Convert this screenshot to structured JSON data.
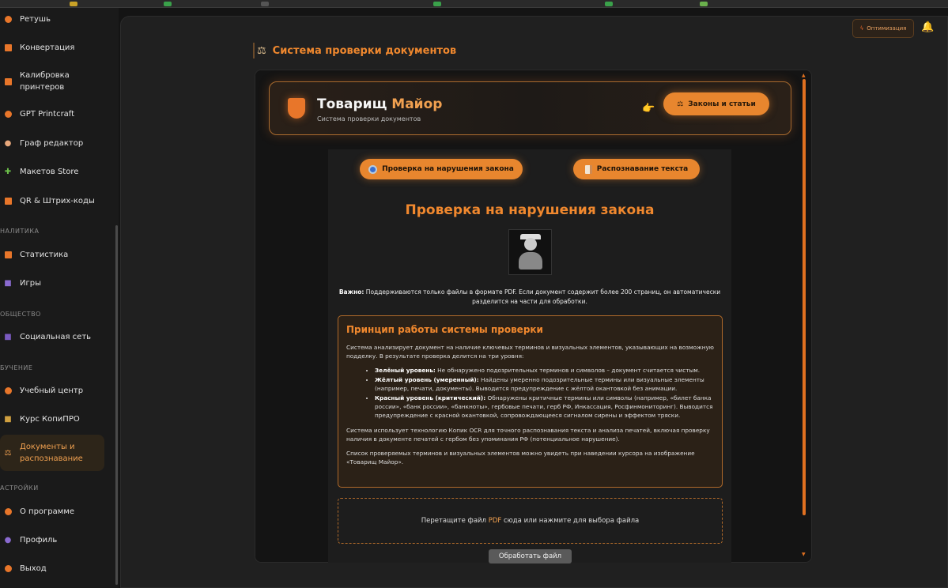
{
  "sidebar": {
    "items": [
      {
        "label": "Ретушь",
        "icon": "retouch-icon"
      },
      {
        "label": "Конвертация",
        "icon": "convert-icon"
      },
      {
        "label": "Калибровка принтеров",
        "icon": "calibration-icon"
      },
      {
        "label": "GPT Printcraft",
        "icon": "gpt-icon"
      },
      {
        "label": "Граф редактор",
        "icon": "palette-icon"
      },
      {
        "label": "Макетов Store",
        "icon": "puzzle-icon"
      },
      {
        "label": "QR & Штрих-коды",
        "icon": "qr-icon"
      },
      {
        "label": "Статистика",
        "icon": "stats-icon"
      },
      {
        "label": "Игры",
        "icon": "gamepad-icon"
      },
      {
        "label": "Социальная сеть",
        "icon": "social-icon"
      },
      {
        "label": "Учебный центр",
        "icon": "education-icon"
      },
      {
        "label": "Курс КопиПРО",
        "icon": "course-icon"
      },
      {
        "label": "Документы и распознавание",
        "icon": "scales-icon"
      },
      {
        "label": "О программе",
        "icon": "about-icon"
      },
      {
        "label": "Профиль",
        "icon": "profile-icon"
      },
      {
        "label": "Выход",
        "icon": "exit-icon"
      }
    ],
    "sections": {
      "analytics": "НАЛИТИКА",
      "society": "ОБЩЕСТВО",
      "learning": "БУЧЕНИЕ",
      "settings": "АСТРОЙКИ"
    }
  },
  "header": {
    "optimize_label": "Оптимизация",
    "section_title": "Система проверки документов"
  },
  "hero": {
    "title_main": "Товарищ ",
    "title_accent": "Майор",
    "subtitle": "Система проверки документов",
    "laws_button": "Законы и статьи"
  },
  "tabs": {
    "check": "Проверка на нарушения закона",
    "ocr": "Распознавание текста"
  },
  "panel": {
    "title": "Проверка на нарушения закона",
    "notice_bold": "Важно:",
    "notice_text": " Поддерживаются только файлы в формате PDF. Если документ содержит более 200 страниц, он автоматически разделится на части для обработки."
  },
  "info": {
    "title": "Принцип работы системы проверки",
    "intro": "Система анализирует документ на наличие ключевых терминов и визуальных элементов, указывающих на возможную подделку. В результате проверка делится на три уровня:",
    "levels": [
      {
        "name": "Зелёный уровень:",
        "text": " Не обнаружено подозрительных терминов и символов – документ считается чистым."
      },
      {
        "name": "Жёлтый уровень (умеренный):",
        "text": " Найдены умеренно подозрительные термины или визуальные элементы (например, печати, документы). Выводится предупреждение с жёлтой окантовкой без анимации."
      },
      {
        "name": "Красный уровень (критический):",
        "text": " Обнаружены критичные термины или символы (например, «билет банка россии», «банк россии», «банкноты», гербовые печати, герб РФ, Инкассация, Росфинмониторинг). Выводится предупреждение с красной окантовкой, сопровождающееся сигналом сирены и эффектом тряски."
      }
    ],
    "tech": "Система использует технологию Копик OCR для точного распознавания текста и анализа печатей, включая проверку наличия в документе печатей с гербом без упоминания РФ (потенциальное нарушение).",
    "hint": "Список проверяемых терминов и визуальных элементов можно увидеть при наведении курсора на изображение «Товарищ Майор»."
  },
  "upload": {
    "text_before": "Перетащите файл ",
    "text_pdf": "PDF",
    "text_after": " сюда или нажмите для выбора файла",
    "process_button": "Обработать файл"
  },
  "colors": {
    "accent": "#e8862e",
    "accent_text": "#f0882e",
    "background": "#141414"
  }
}
